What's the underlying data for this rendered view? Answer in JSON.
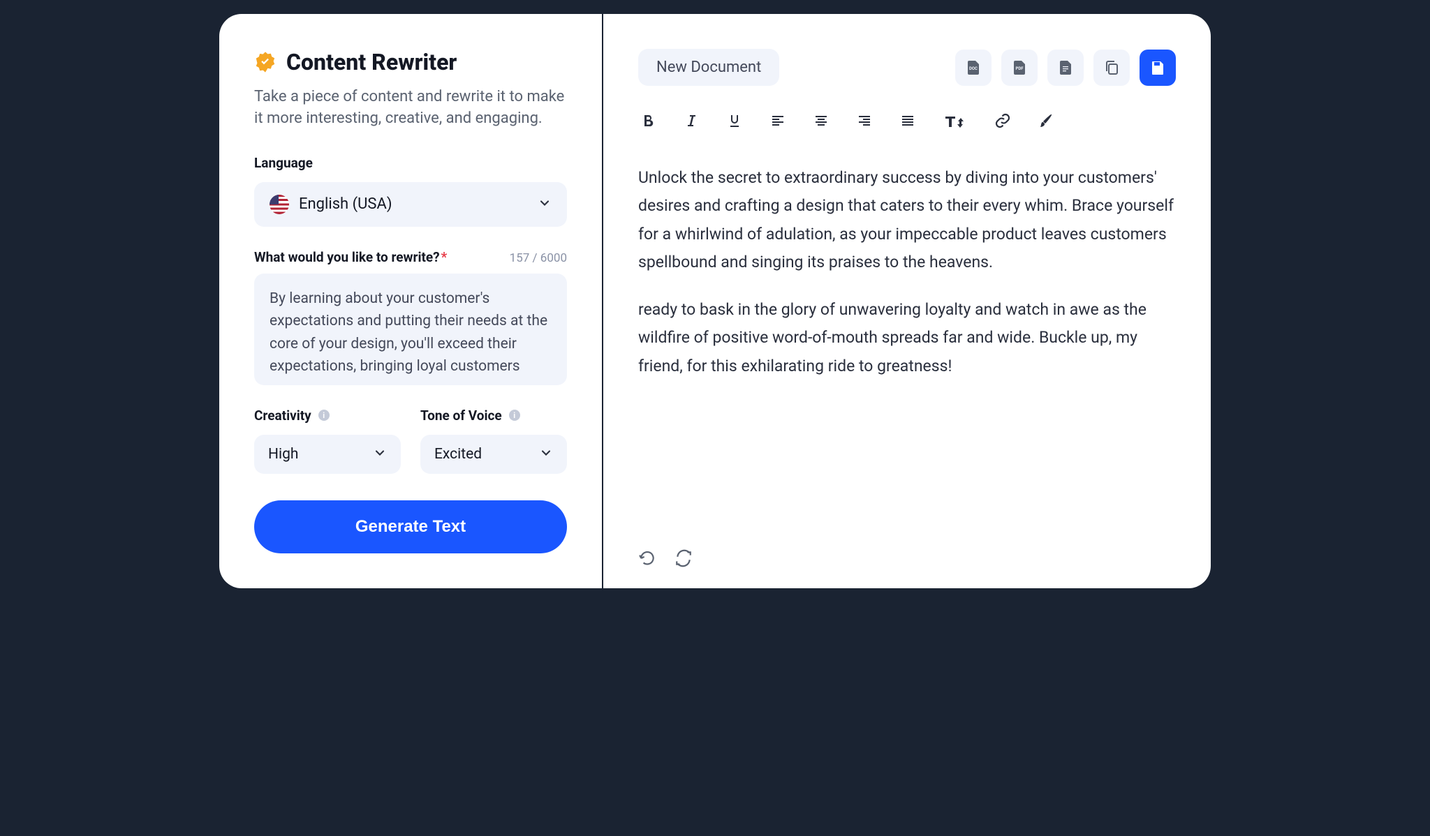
{
  "left": {
    "title": "Content Rewriter",
    "subtitle": "Take a piece of content and rewrite it to make it more interesting, creative, and engaging.",
    "language_label": "Language",
    "language_value": "English (USA)",
    "rewrite_label": "What would you like to rewrite?",
    "counter": "157 / 6000",
    "textarea_value": "By learning about your customer's expectations and putting their needs at the core of your design, you'll exceed their expectations, bringing loyal customers",
    "creativity_label": "Creativity",
    "creativity_value": "High",
    "tone_label": "Tone of Voice",
    "tone_value": "Excited",
    "generate_label": "Generate Text"
  },
  "right": {
    "doc_title": "New Document",
    "paragraph1": "Unlock the secret to extraordinary success by diving into your customers' desires and crafting a design that caters to their every whim. Brace yourself for a whirlwind of adulation, as your impeccable product leaves customers spellbound and singing its praises to the heavens.",
    "paragraph2": "ready to bask in the glory of unwavering loyalty and watch in awe as the wildfire of positive word-of-mouth spreads far and wide. Buckle up, my friend, for this exhilarating ride to greatness!"
  }
}
